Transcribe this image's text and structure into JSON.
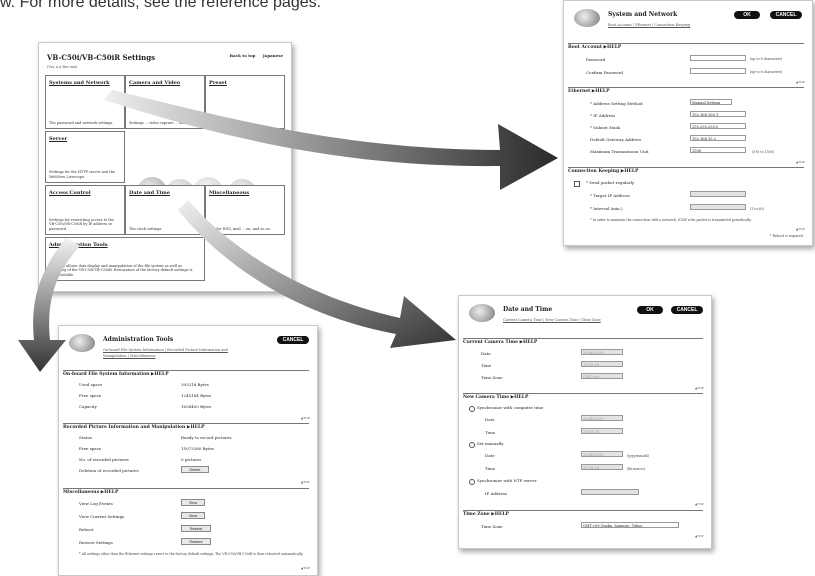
{
  "intro": "w. For more details, see the reference pages.",
  "main_menu": {
    "title": "VB-C50i/VB-C50iR Settings",
    "version": "(Ver. x.x Rev xxx)",
    "links": [
      "Back to top",
      "Japanese"
    ],
    "cells": [
      {
        "title": "Systems and Network",
        "desc": "The password and network settings."
      },
      {
        "title": "Camera and Video",
        "desc": "Settings ... video capture ... and so on."
      },
      {
        "title": "Preset",
        "desc": ""
      },
      {
        "title": "Server",
        "desc": "Settings for the HTTP server and the WebView Livescope."
      },
      {
        "title": "Access Control",
        "desc": "Settings for restricting access to the VB-C50i/VB-C50iR by IP address or password."
      },
      {
        "title": "Date and Time",
        "desc": "The clock settings."
      },
      {
        "title": "Miscellaneous",
        "desc": "... s for DNS, mail ... on, and so on."
      },
      {
        "title": "Administration Tools",
        "desc": "...is page allows data display and manipulation of the file system as well as rebooting of the VB-C50i/VB-C50iR. Restoration of the factory default settings is also available."
      }
    ]
  },
  "network_panel": {
    "title": "System and Network",
    "ok": "OK",
    "cancel": "CANCEL",
    "subnav": "Root Account | Ethernet | Connection Keeping",
    "root_section": "Root Account ▶HELP",
    "password_label": "Password",
    "password_hint": "(up to 8 characters)",
    "confirm_label": "Confirm Password",
    "confirm_hint": "(up to 8 characters)",
    "ethernet_section": "Ethernet ▶HELP",
    "method_label": "* Address Setting Method",
    "method_value": "Manual Setting",
    "ip_label": "* IP Address",
    "ip_value": "192.168.100.1",
    "mask_label": "* Subnet Mask",
    "mask_value": "255.255.255.0",
    "gateway_label": "Default Gateway Address",
    "gateway_value": "192.168.13.2",
    "mtu_label": "Maximum Transmission Unit",
    "mtu_value": "1500",
    "mtu_hint": "(376 to 1500)",
    "keep_section": "Connection Keeping ▶HELP",
    "send_label": "* Send packet regularly",
    "target_label": "* Target IP Address",
    "interval_label": "* Interval (min.)",
    "interval_hint": "(1 to 60)",
    "note": "* In order to maintain the connection with a network, ICMP echo packet is transmitted periodically.",
    "reboot_note": "* Reboot is required.",
    "top": "▲TOP"
  },
  "admin_panel": {
    "title": "Administration Tools",
    "cancel": "CANCEL",
    "subnav1": "On-board File System Information | Recorded Picture Information and",
    "subnav2": "Manipulation | Miscellaneous",
    "fs_section": "On-board File System Information ▶HELP",
    "fs_rows": [
      {
        "label": "Used space",
        "value": "393216 Bytes"
      },
      {
        "label": "Free space",
        "value": "1245184 Bytes"
      },
      {
        "label": "Capacity",
        "value": "1638400 Bytes"
      }
    ],
    "rec_section": "Recorded Picture Information and Manipulation ▶HELP",
    "rec_rows": [
      {
        "label": "Status",
        "value": "Ready to record pictures."
      },
      {
        "label": "Free space",
        "value": "15073280 Bytes"
      },
      {
        "label": "No. of recorded pictures",
        "value": "0 pictures"
      },
      {
        "label": "Deletion of recorded pictures",
        "value": ""
      }
    ],
    "delete_btn": "Delete",
    "misc_section": "Miscellaneous ▶HELP",
    "misc_rows": [
      {
        "label": "View Log Events",
        "btn": "View"
      },
      {
        "label": "View Current Settings",
        "btn": "View"
      },
      {
        "label": "Reboot",
        "btn": "Reboot"
      },
      {
        "label": "Restore Settings",
        "btn": "Restore"
      }
    ],
    "note": "* All settings other than the Ethernet settings revert to the factory default settings. The VB-C50i/VB-C50iR is then rebooted automatically.",
    "top": "▲TOP"
  },
  "date_panel": {
    "title": "Date and Time",
    "ok": "OK",
    "cancel": "CANCEL",
    "subnav": "Current Camera Time | New Camera Time | Time Zone",
    "current_section": "Current Camera Time ▶HELP",
    "cur_date_label": "Date",
    "cur_date_value": "2004/05/30",
    "cur_time_label": "Time",
    "cur_time_value": "20:15:16",
    "cur_tz_label": "Time Zone",
    "cur_tz_value": "GMT+09",
    "new_section": "New Camera Time ▶HELP",
    "sync_pc": "Synchronize with computer time",
    "new_date_label": "Date",
    "new_date_value": "2004/05/30",
    "new_time_label": "Time",
    "new_time_value": "20:18:25",
    "manual": "Set manually",
    "man_date_label": "Date",
    "man_date_value": "2004/05/30",
    "man_date_hint": "(yyyy/mm/dd)",
    "man_time_label": "Time",
    "man_time_value": "20:18:16",
    "man_time_hint": "(hh:mm:ss)",
    "ntp": "Synchronize with NTP server",
    "ntp_ip_label": "IP Address",
    "tz_section": "Time Zone ▶HELP",
    "tz_label": "Time Zone",
    "tz_value": "GMT+09 Osaka, Sapporo, Tokyo",
    "top": "▲TOP"
  }
}
